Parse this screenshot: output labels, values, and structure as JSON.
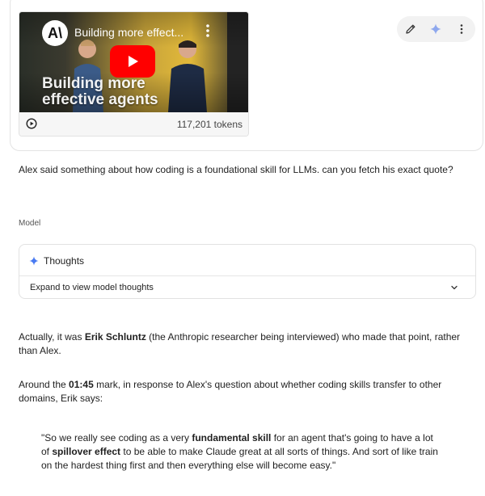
{
  "video": {
    "channel_logo": "A\\",
    "title": "Building more effect...",
    "overlay_title_line1": "Building more",
    "overlay_title_line2": "effective agents",
    "tokens": "117,201 tokens"
  },
  "toolbar": {
    "icons": [
      "pencil-icon",
      "sparkle-icon",
      "more-vert-icon"
    ]
  },
  "prompt": {
    "text": "Alex said something about how coding is a foundational skill for LLMs. can you fetch his exact quote?"
  },
  "response": {
    "model_label": "Model",
    "thoughts": {
      "title": "Thoughts",
      "expand_label": "Expand to view model thoughts"
    },
    "para1": {
      "prefix": "Actually, it was ",
      "bold": "Erik Schluntz",
      "suffix_line1": " (the Anthropic researcher being interviewed) who made that point, rather",
      "line2": "than Alex."
    },
    "para2": {
      "prefix": "Around the ",
      "bold": "01:45",
      "suffix_line1": " mark, in response to Alex's question about whether coding skills transfer to other",
      "line2": "domains, Erik says:"
    },
    "quote": {
      "l1_prefix": "\"So we really see coding as a very ",
      "l1_bold": "fundamental skill",
      "l1_suffix": " for an agent that's going to have a lot",
      "l2_prefix": "of ",
      "l2_bold": "spillover effect",
      "l2_suffix": " to be able to make Claude great at all sorts of things. And sort of like train",
      "l3": "on the hardest thing first and then everything else will become easy.\""
    }
  },
  "colors": {
    "youtube_red": "#ff0000",
    "sparkle_blue": "#4a7bf2",
    "toolbar_bg": "#f2f2f2"
  }
}
